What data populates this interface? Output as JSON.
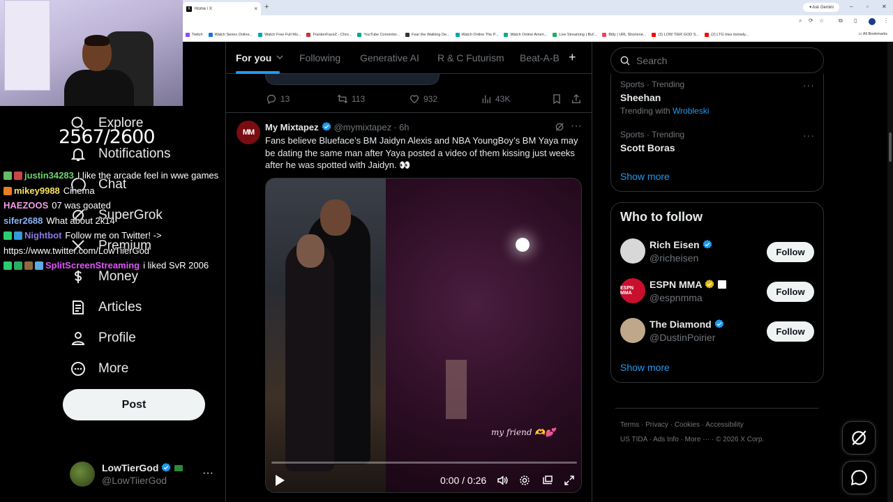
{
  "browser": {
    "tab_title": "Home / X",
    "tab_favicon": "X",
    "ask_gemini": "Ask Gemini",
    "bookmarks": [
      {
        "label": "Twitch",
        "color": "#9146ff"
      },
      {
        "label": "Watch Series Online...",
        "color": "#1a73e8"
      },
      {
        "label": "Watch Free Full Mo...",
        "color": "#0aa"
      },
      {
        "label": "FrankerFaceZ - Chro...",
        "color": "#c33"
      },
      {
        "label": "YouTube Converter...",
        "color": "#0a8"
      },
      {
        "label": "Fear the Walking De...",
        "color": "#333"
      },
      {
        "label": "Watch Online The P...",
        "color": "#0aa"
      },
      {
        "label": "Watch Online Ameri...",
        "color": "#1a8"
      },
      {
        "label": "Live Streaming | Buf...",
        "color": "#2a6"
      },
      {
        "label": "Bitly | URL Shortene...",
        "color": "#e46"
      },
      {
        "label": "(2) LOW TIER GOD S...",
        "color": "#f00"
      },
      {
        "label": "(2) LTG tries itslowly...",
        "color": "#f00"
      }
    ],
    "all_bookmarks": "All Bookmarks"
  },
  "stream_overlay": {
    "counter": "2567/2600",
    "chat": [
      {
        "user": "justin34283",
        "user_color": "#6dd36d",
        "message": "I like the arcade feel in wwe games",
        "badges": [
          "#6b6",
          "#c44"
        ]
      },
      {
        "user": "mikey9988",
        "user_color": "#f7e35a",
        "message": "Cinema",
        "badges": [
          "#e67e22"
        ]
      },
      {
        "user": "HAEZOOS",
        "user_color": "#f59de6",
        "message": "07 was goated",
        "badges": []
      },
      {
        "user": "sifer2688",
        "user_color": "#8ab4f8",
        "message": "What about 2k14",
        "badges": []
      },
      {
        "user": "Nightbot",
        "user_color": "#8c7ae6",
        "message": "Follow me on Twitter! -> https://www.twitter.com/LowTiierGod",
        "badges": [
          "#2ecc71",
          "#3498db"
        ]
      },
      {
        "user": "SplitScreenStreaming",
        "user_color": "#e056fd",
        "message": "i liked SvR 2006",
        "badges": [
          "#2ecc71",
          "#27ae60",
          "#8e6b3d",
          "#5dade2"
        ]
      }
    ]
  },
  "nav": {
    "items": [
      {
        "label": "Explore",
        "icon": "search-icon"
      },
      {
        "label": "Notifications",
        "icon": "bell-icon"
      },
      {
        "label": "Chat",
        "icon": "chat-icon"
      },
      {
        "label": "SuperGrok",
        "icon": "grok-icon"
      },
      {
        "label": "Premium",
        "icon": "x-icon"
      },
      {
        "label": "Money",
        "icon": "money-icon"
      },
      {
        "label": "Articles",
        "icon": "articles-icon"
      },
      {
        "label": "Profile",
        "icon": "person-icon"
      },
      {
        "label": "More",
        "icon": "more-circle-icon"
      }
    ],
    "post_button": "Post",
    "account": {
      "name": "LowTierGod",
      "handle": "@LowTiierGod"
    }
  },
  "feed": {
    "tabs": [
      "For you",
      "Following",
      "Generative AI",
      "R & C Futurism",
      "Beat-A-B"
    ],
    "active_tab": "For you",
    "prev_actions": {
      "replies": "13",
      "reposts": "113",
      "likes": "932",
      "views": "43K"
    },
    "tweet": {
      "avatar_text": "MM",
      "name": "My Mixtapez",
      "handle": "@mymixtapez",
      "time": "· 6h",
      "text": "Fans believe Blueface’s BM Jaidyn Alexis and NBA YoungBoy’s BM Yaya may be dating the same man after Yaya posted a video of them kissing just weeks after he was spotted with Jaidyn. 👀",
      "video_caption": "my friend 🫶💕",
      "video_time": "0:00 / 0:26",
      "video_progress": 0
    }
  },
  "sidebar": {
    "search_placeholder": "Search",
    "trends": [
      {
        "meta": "Sports · Trending",
        "name": "Sheehan",
        "with_prefix": "Trending with",
        "with_link": "Wrobleski"
      },
      {
        "meta": "Sports · Trending",
        "name": "Scott Boras"
      }
    ],
    "show_more": "Show more",
    "who_to_follow_title": "Who to follow",
    "accounts": [
      {
        "name": "Rich Eisen",
        "handle": "@richeisen",
        "badge": "blue",
        "avatar_color": "#d8d8d8"
      },
      {
        "name": "ESPN MMA",
        "handle": "@espnmma",
        "badge": "gold",
        "avatar_color": "#c8102e",
        "avatar_text": "ESPN MMA"
      },
      {
        "name": "The Diamond",
        "handle": "@DustinPoirier",
        "badge": "blue",
        "avatar_color": "#bfa88a"
      }
    ],
    "follow_label": "Follow",
    "footer": {
      "line1": [
        "Terms",
        "Privacy",
        "Cookies",
        "Accessibility"
      ],
      "line2": [
        "US TIDA",
        "Ads Info",
        "More ···",
        "© 2026 X Corp."
      ]
    }
  }
}
